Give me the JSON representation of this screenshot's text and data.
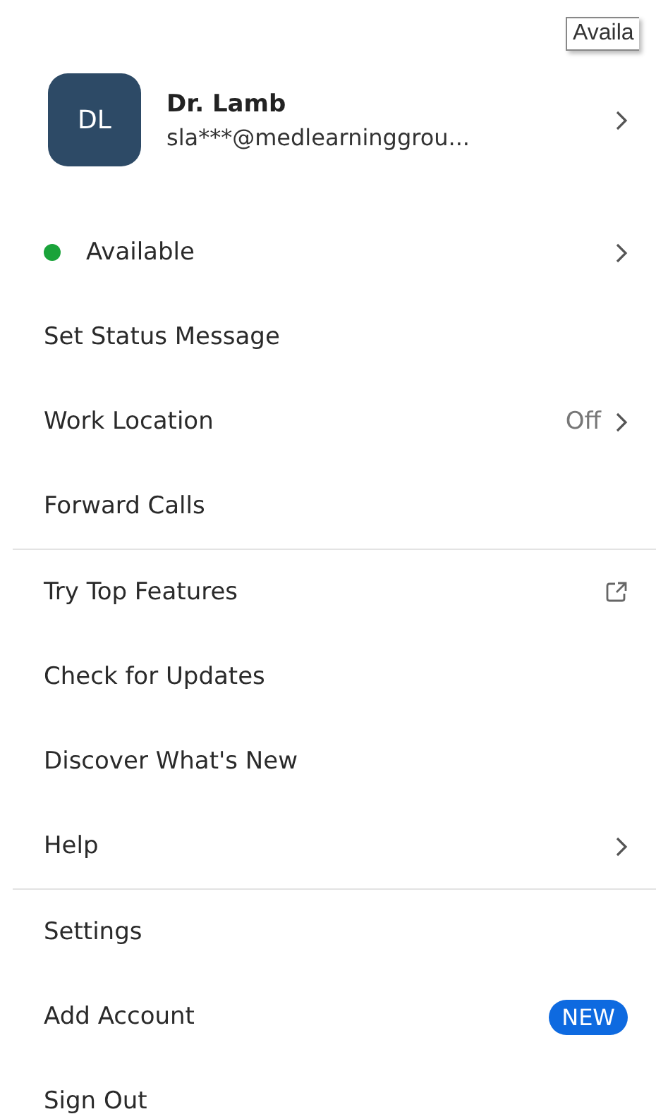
{
  "tooltip": {
    "text": "Availa"
  },
  "profile": {
    "initials": "DL",
    "name": "Dr. Lamb",
    "email": "sla***@medlearninggrou...",
    "chevron": true
  },
  "sections": [
    {
      "items": [
        {
          "kind": "status",
          "label": "Available",
          "color": "#1aa33a",
          "chevron": true
        },
        {
          "kind": "plain",
          "label": "Set Status Message",
          "chevron": false
        },
        {
          "kind": "value",
          "label": "Work Location",
          "value": "Off",
          "chevron": true
        },
        {
          "kind": "plain",
          "label": "Forward Calls",
          "chevron": false
        }
      ]
    },
    {
      "items": [
        {
          "kind": "external",
          "label": "Try Top Features",
          "chevron": false
        },
        {
          "kind": "plain",
          "label": "Check for Updates",
          "chevron": false
        },
        {
          "kind": "plain",
          "label": "Discover What's New",
          "chevron": false
        },
        {
          "kind": "plain",
          "label": "Help",
          "chevron": true
        }
      ]
    },
    {
      "items": [
        {
          "kind": "plain",
          "label": "Settings",
          "chevron": false
        },
        {
          "kind": "badge",
          "label": "Add Account",
          "badge": "NEW",
          "chevron": false
        },
        {
          "kind": "plain",
          "label": "Sign Out",
          "chevron": false
        }
      ]
    }
  ]
}
